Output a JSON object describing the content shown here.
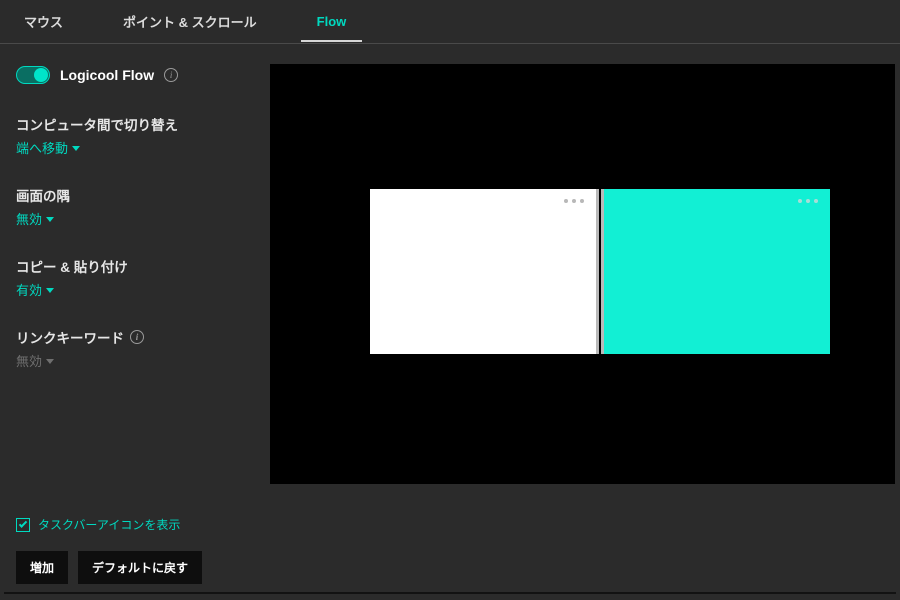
{
  "tabs": {
    "mouse": "マウス",
    "point_scroll": "ポイント & スクロール",
    "flow": "Flow"
  },
  "flow": {
    "title": "Logicool Flow",
    "toggle_on": true
  },
  "options": {
    "switch": {
      "label": "コンピュータ間で切り替え",
      "value": "端へ移動"
    },
    "corner": {
      "label": "画面の隅",
      "value": "無効"
    },
    "copypaste": {
      "label": "コピー & 貼り付け",
      "value": "有効"
    },
    "linkkeyword": {
      "label": "リンクキーワード",
      "value": "無効"
    }
  },
  "taskbar": {
    "label": "タスクバーアイコンを表示",
    "checked": true
  },
  "buttons": {
    "add": "増加",
    "reset": "デフォルトに戻す"
  },
  "colors": {
    "accent": "#00d9c0",
    "monitor_active": "#12efd4"
  }
}
